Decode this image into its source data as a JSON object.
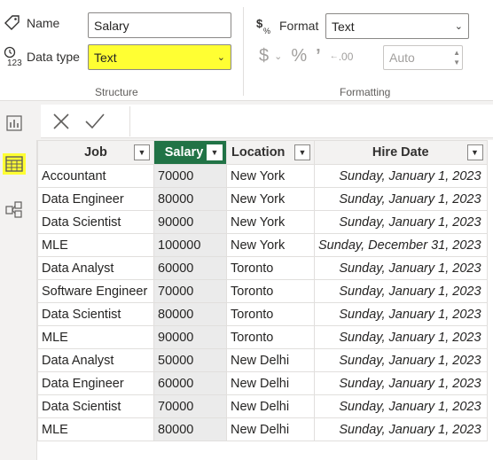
{
  "ribbon": {
    "name_label": "Name",
    "name_value": "Salary",
    "datatype_label": "Data type",
    "datatype_value": "Text",
    "structure_group": "Structure",
    "format_label": "Format",
    "format_value": "Text",
    "currency_symbol": "$",
    "percent_symbol": "%",
    "comma_symbol": "’",
    "decimal_symbol": ".00",
    "auto_value": "Auto",
    "formatting_group": "Formatting"
  },
  "rail": {
    "items": [
      {
        "icon": "report-view-icon",
        "active": false
      },
      {
        "icon": "table-view-icon",
        "active": true
      },
      {
        "icon": "model-view-icon",
        "active": false
      }
    ]
  },
  "formula_bar": {
    "cancel_icon": "close-icon",
    "commit_icon": "check-icon"
  },
  "table": {
    "columns": [
      "Job",
      "Salary",
      "Location",
      "Hire Date"
    ],
    "selected_column": "Salary",
    "rows": [
      [
        "Accountant",
        "70000",
        "New York",
        "Sunday, January 1, 2023"
      ],
      [
        "Data Engineer",
        "80000",
        "New York",
        "Sunday, January 1, 2023"
      ],
      [
        "Data Scientist",
        "90000",
        "New York",
        "Sunday, January 1, 2023"
      ],
      [
        "MLE",
        "100000",
        "New York",
        "Sunday, December 31, 2023"
      ],
      [
        "Data Analyst",
        "60000",
        "Toronto",
        "Sunday, January 1, 2023"
      ],
      [
        "Software Engineer",
        "70000",
        "Toronto",
        "Sunday, January 1, 2023"
      ],
      [
        "Data Scientist",
        "80000",
        "Toronto",
        "Sunday, January 1, 2023"
      ],
      [
        "MLE",
        "90000",
        "Toronto",
        "Sunday, January 1, 2023"
      ],
      [
        "Data Analyst",
        "50000",
        "New Delhi",
        "Sunday, January 1, 2023"
      ],
      [
        "Data Engineer",
        "60000",
        "New Delhi",
        "Sunday, January 1, 2023"
      ],
      [
        "Data Scientist",
        "70000",
        "New Delhi",
        "Sunday, January 1, 2023"
      ],
      [
        "MLE",
        "80000",
        "New Delhi",
        "Sunday, January 1, 2023"
      ]
    ]
  },
  "colors": {
    "selected_header": "#217346",
    "highlight": "#ffff33"
  }
}
